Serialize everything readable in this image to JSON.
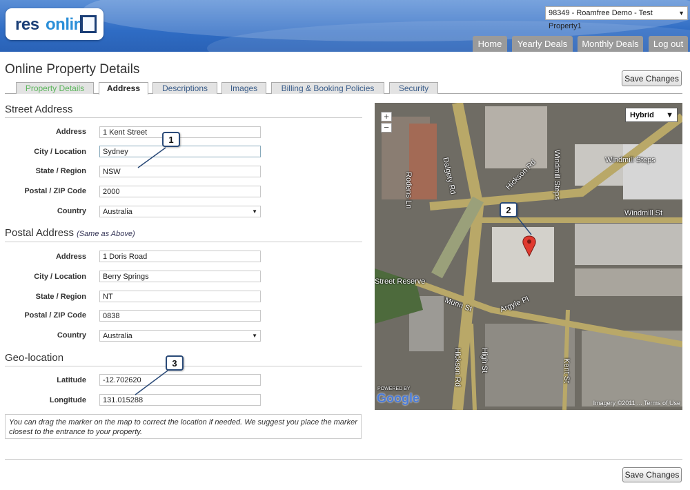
{
  "header": {
    "logo_text_1": "res",
    "logo_text_2": "online",
    "property_selector": "98349 - Roamfree Demo - Test Property1",
    "nav": [
      "Home",
      "Yearly Deals",
      "Monthly Deals",
      "Log out"
    ]
  },
  "page": {
    "title": "Online Property Details",
    "save_label": "Save Changes"
  },
  "tabs": [
    "Property Details",
    "Address",
    "Descriptions",
    "Images",
    "Billing & Booking Policies",
    "Security"
  ],
  "street": {
    "title": "Street Address",
    "fields": {
      "address_label": "Address",
      "address": "1 Kent Street",
      "city_label": "City / Location",
      "city": "Sydney",
      "state_label": "State / Region",
      "state": "NSW",
      "zip_label": "Postal / ZIP Code",
      "zip": "2000",
      "country_label": "Country",
      "country": "Australia"
    }
  },
  "postal": {
    "title": "Postal Address",
    "subtitle": "(Same as Above)",
    "fields": {
      "address_label": "Address",
      "address": "1 Doris Road",
      "city_label": "City / Location",
      "city": "Berry Springs",
      "state_label": "State / Region",
      "state": "NT",
      "zip_label": "Postal / ZIP Code",
      "zip": "0838",
      "country_label": "Country",
      "country": "Australia"
    }
  },
  "geo": {
    "title": "Geo-location",
    "latitude_label": "Latitude",
    "latitude": "-12.702620",
    "longitude_label": "Longitude",
    "longitude": "131.015288",
    "note": "You can drag the marker on the map to correct the location if needed. We suggest you place the marker closest to the entrance to your property."
  },
  "callouts": [
    "1",
    "2",
    "3"
  ],
  "map": {
    "type_selected": "Hybrid",
    "zoom_in": "+",
    "zoom_out": "−",
    "streets": [
      "Dalgety Rd",
      "Hickson Rd",
      "Windmill Steps",
      "Windmill St",
      "Argyle Pl",
      "Munn St",
      "Hickson Rd",
      "High St",
      "Kent St",
      "Rodens Ln"
    ],
    "places": [
      "Windmill Steps",
      "Street Reserve"
    ],
    "powered_by": "POWERED BY",
    "google": "Google",
    "imagery": "Imagery ©2011 ... Terms of Use",
    "marker_color": "#e03a2f"
  },
  "colors": {
    "header_blue": "#2f6cc4",
    "tab_green": "#5bb55b",
    "callout_border": "#2a4a78"
  }
}
